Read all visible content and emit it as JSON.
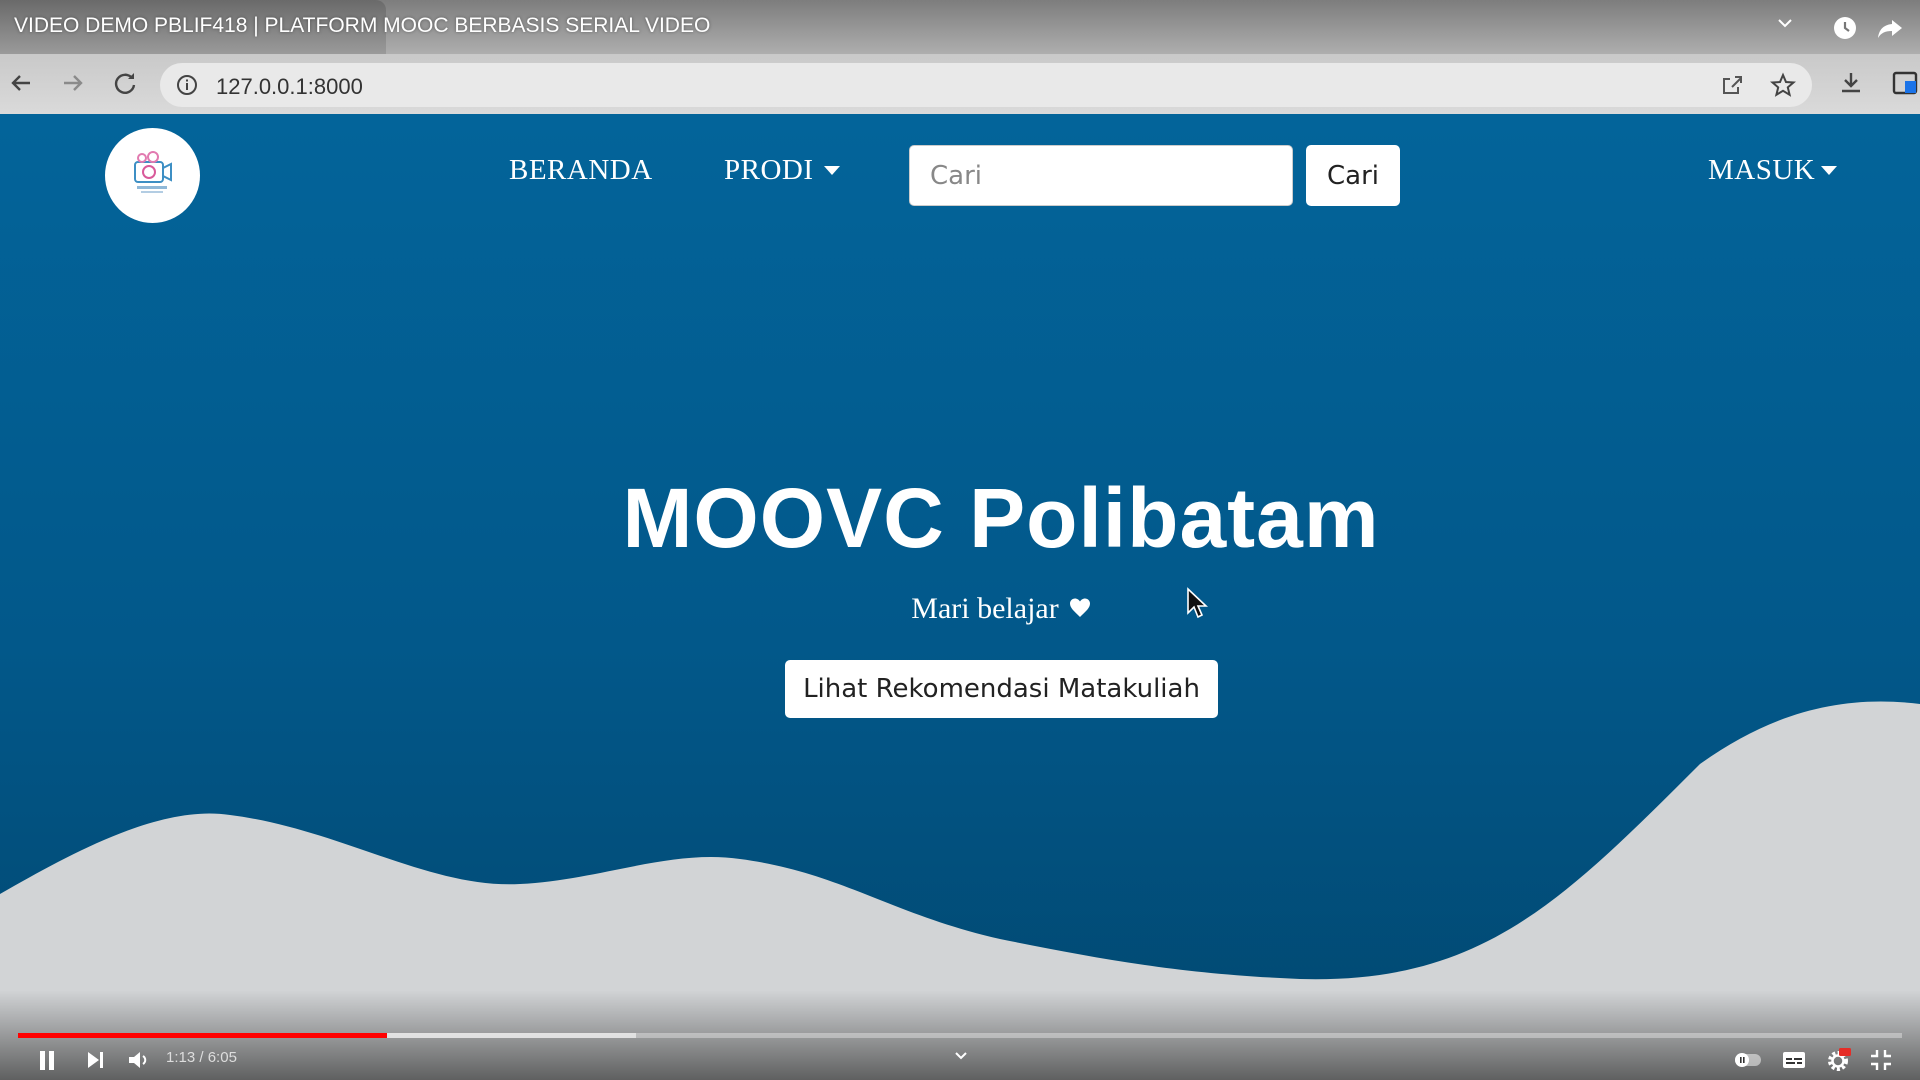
{
  "video": {
    "title": "VIDEO DEMO PBLIF418 | PLATFORM MOOC BERBASIS SERIAL VIDEO",
    "time_current": "1:13",
    "time_separator": "/",
    "time_total": "6:05",
    "progress_played": 0.196,
    "progress_buffered": 0.328
  },
  "browser": {
    "url": "127.0.0.1:8000"
  },
  "site": {
    "nav": {
      "home_label": "BERANDA",
      "prodi_label": "PRODI",
      "login_label": "MASUK"
    },
    "search": {
      "placeholder": "Cari",
      "button_label": "Cari"
    },
    "hero": {
      "title": "MOOVC Polibatam",
      "subtitle": "Mari belajar",
      "cta_label": "Lihat Rekomendasi Matakuliah"
    }
  },
  "colors": {
    "page_bg": "#03649a",
    "wave": "#d9d9d9",
    "progress_red": "#ff0000"
  }
}
